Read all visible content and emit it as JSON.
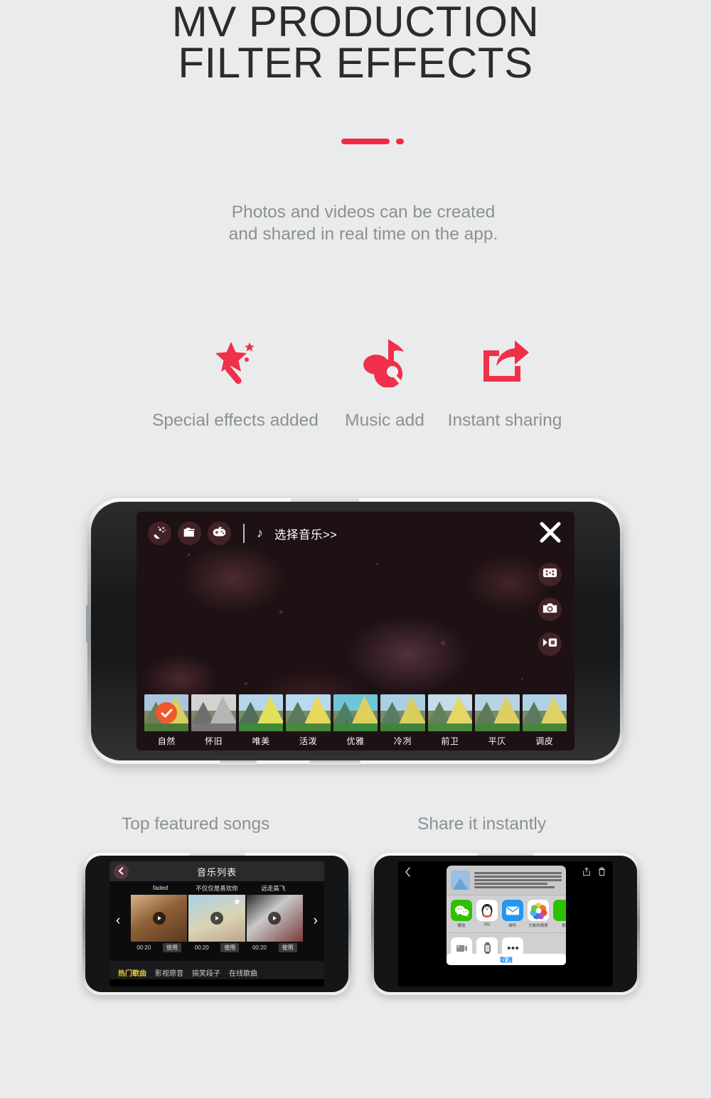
{
  "header": {
    "title_line1": "MV PRODUCTION",
    "title_line2": "FILTER EFFECTS",
    "accent_color": "#f22b45",
    "subtitle_line1": "Photos and videos can be created",
    "subtitle_line2": "and shared in real time on the app."
  },
  "features": [
    {
      "icon": "magic-wand-icon",
      "label": "Special effects added"
    },
    {
      "icon": "music-disc-icon",
      "label": "Music add"
    },
    {
      "icon": "share-arrow-icon",
      "label": "Instant sharing"
    }
  ],
  "main_phone": {
    "toolbar": {
      "effects_icon": "magic-wand-icon",
      "folder_icon": "folder-icon",
      "game_icon": "game-controller-icon",
      "music_note_icon": "music-note-icon",
      "music_label": "选择音乐>>"
    },
    "right_controls": [
      {
        "icon": "close-x-icon",
        "name": "close-button"
      },
      {
        "icon": "filter-grid-icon",
        "name": "filter-button"
      },
      {
        "icon": "camera-icon",
        "name": "camera-button"
      },
      {
        "icon": "video-icon",
        "name": "video-button"
      }
    ],
    "filters": [
      {
        "label": "自然",
        "selected": true,
        "sky": "#a9c6dd",
        "mtn": "#6d7f57",
        "mtn2": "#d6cf62",
        "grass": "#4f7a3a"
      },
      {
        "label": "怀旧",
        "selected": false,
        "sky": "#d3d3d3",
        "mtn": "#6e6e6e",
        "mtn2": "#b5b5b5",
        "grass": "#777777"
      },
      {
        "label": "唯美",
        "selected": false,
        "sky": "#b5d5e8",
        "mtn": "#4f6f5a",
        "mtn2": "#e2e05a",
        "grass": "#3f8a3a"
      },
      {
        "label": "活泼",
        "selected": false,
        "sky": "#b9d9ee",
        "mtn": "#5b7a5f",
        "mtn2": "#e8d95b",
        "grass": "#46893c"
      },
      {
        "label": "优雅",
        "selected": false,
        "sky": "#6fc6d8",
        "mtn": "#4e7f63",
        "mtn2": "#ddd05c",
        "grass": "#3e8a40"
      },
      {
        "label": "冷冽",
        "selected": false,
        "sky": "#a9cfe3",
        "mtn": "#5a7b62",
        "mtn2": "#d9cd5e",
        "grass": "#42833c"
      },
      {
        "label": "前卫",
        "selected": false,
        "sky": "#c6dcea",
        "mtn": "#647f5c",
        "mtn2": "#e4d765",
        "grass": "#4a8a3d"
      },
      {
        "label": "平仄",
        "selected": false,
        "sky": "#b8d3e6",
        "mtn": "#5f7a5b",
        "mtn2": "#dccf61",
        "grass": "#458539"
      },
      {
        "label": "调皮",
        "selected": false,
        "sky": "#b0d2e7",
        "mtn": "#5c7a5e",
        "mtn2": "#dfd265",
        "grass": "#47873c"
      }
    ]
  },
  "bottom": {
    "caption_left": "Top featured songs",
    "caption_right": "Share it instantly"
  },
  "music_phone": {
    "back_icon": "chevron-left-icon",
    "title": "音乐列表",
    "songs": [
      {
        "name": "faded",
        "time": "00:20",
        "use": "使用",
        "starred": false
      },
      {
        "name": "不仅仅是喜欢你",
        "time": "00:20",
        "use": "使用",
        "starred": true
      },
      {
        "name": "远走高飞",
        "time": "00:20",
        "use": "使用",
        "starred": false
      }
    ],
    "prev_arrow": "‹",
    "next_arrow": "›",
    "tabs": [
      {
        "label": "热门歌曲",
        "active": true
      },
      {
        "label": "影视原音",
        "active": false
      },
      {
        "label": "搞笑段子",
        "active": false
      },
      {
        "label": "在线歌曲",
        "active": false
      }
    ]
  },
  "share_phone": {
    "back_icon": "chevron-left-icon",
    "top_icons": [
      {
        "icon": "share-icon",
        "name": "share-button"
      },
      {
        "icon": "trash-icon",
        "name": "delete-button"
      }
    ],
    "apps": [
      {
        "name": "wechat-app-icon",
        "label": "微信",
        "color": "#2dc100"
      },
      {
        "name": "qq-app-icon",
        "label": "QQ",
        "color": "#ffffff"
      },
      {
        "name": "mail-app-icon",
        "label": "邮件",
        "color": "#2196f3"
      },
      {
        "name": "photos-app-icon",
        "label": "大象的相册",
        "color": "#ffffff"
      },
      {
        "name": "wechat-moments-icon",
        "label": "朋",
        "color": "#2dc100"
      }
    ],
    "actions": [
      {
        "name": "save-video-icon"
      },
      {
        "name": "watch-icon"
      },
      {
        "name": "more-icon"
      }
    ],
    "cancel_label": "取消"
  }
}
